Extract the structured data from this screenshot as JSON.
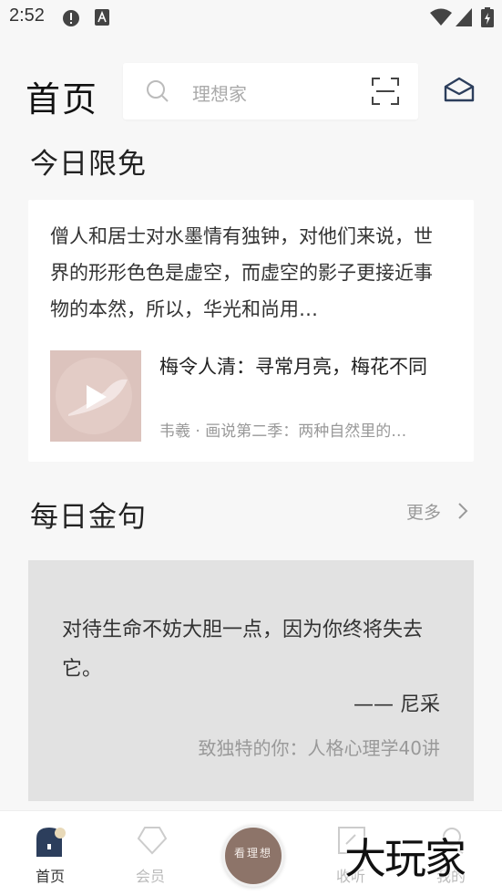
{
  "status_bar": {
    "time": "2:52",
    "icons": [
      "alert-icon",
      "text-a-icon",
      "wifi-icon",
      "signal-icon",
      "battery-icon"
    ]
  },
  "header": {
    "title": "首页",
    "search_placeholder": "理想家",
    "icons": [
      "search-icon",
      "scan-icon",
      "mail-icon"
    ]
  },
  "free_today": {
    "title": "今日限免",
    "description": "僧人和居士对水墨情有独钟，对他们来说，世界的形形色色是虚空，而虚空的影子更接近事物的本然，所以，华光和尚用…",
    "course_title": "梅令人清：寻常月亮，梅花不同",
    "course_subtitle": "韦羲 · 画说第二季：两种自然里的…",
    "thumb_color": "#dcc3bd"
  },
  "daily_quote": {
    "title": "每日金句",
    "more_label": "更多",
    "quote": "对待生命不妨大胆一点，因为你终将失去它。",
    "author": "—— 尼采",
    "source": "致独特的你：人格心理学40讲",
    "card_color": "#e2e2e2"
  },
  "tab_bar": {
    "tabs": [
      {
        "label": "首页",
        "icon": "home-icon",
        "active": true
      },
      {
        "label": "会员",
        "icon": "diamond-icon",
        "active": false
      },
      {
        "label": "收听",
        "icon": "listen-icon",
        "active": false
      },
      {
        "label": "我的",
        "icon": "profile-icon",
        "active": false
      }
    ],
    "center_label": "看理想",
    "center_color": "#8d7469"
  },
  "watermark": "大玩家",
  "colors": {
    "background": "#f7f7f7",
    "accent": "#2c3e5c",
    "muted_text": "#999999"
  }
}
